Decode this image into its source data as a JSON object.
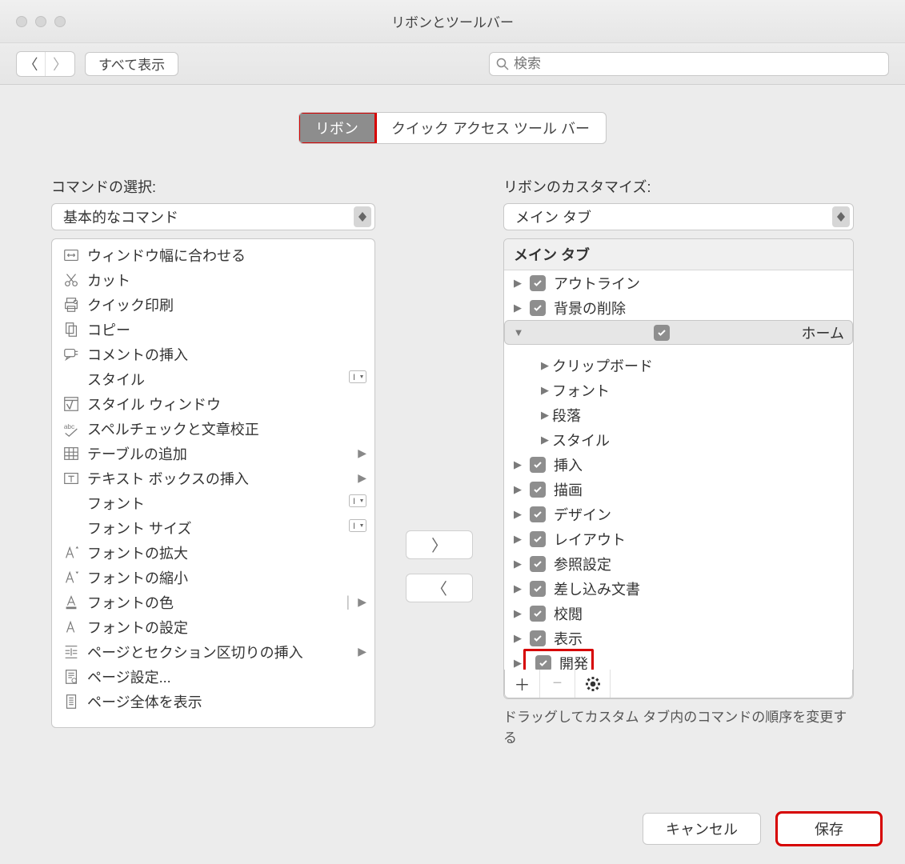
{
  "window": {
    "title": "リボンとツールバー"
  },
  "toolbar": {
    "show_all": "すべて表示",
    "search_placeholder": "検索"
  },
  "tabs": {
    "ribbon": "リボン",
    "qat": "クイック アクセス ツール バー"
  },
  "left": {
    "label": "コマンドの選択:",
    "select_value": "基本的なコマンド",
    "items": [
      {
        "label": "ウィンドウ幅に合わせる",
        "icon": "fitwidth"
      },
      {
        "label": "カット",
        "icon": "cut"
      },
      {
        "label": "クイック印刷",
        "icon": "print"
      },
      {
        "label": "コピー",
        "icon": "copy"
      },
      {
        "label": "コメントの挿入",
        "icon": "comment"
      },
      {
        "label": "スタイル",
        "icon": "",
        "extra": "style"
      },
      {
        "label": "スタイル ウィンドウ",
        "icon": "stylewin"
      },
      {
        "label": "スペルチェックと文章校正",
        "icon": "spell"
      },
      {
        "label": "テーブルの追加",
        "icon": "table",
        "sub": true
      },
      {
        "label": "テキスト ボックスの挿入",
        "icon": "textbox",
        "sub": true
      },
      {
        "label": "フォント",
        "icon": "",
        "extra": "style"
      },
      {
        "label": "フォント サイズ",
        "icon": "",
        "extra": "style"
      },
      {
        "label": "フォントの拡大",
        "icon": "fontplus"
      },
      {
        "label": "フォントの縮小",
        "icon": "fontminus"
      },
      {
        "label": "フォントの色",
        "icon": "fontcolor",
        "sub": true,
        "sep": true
      },
      {
        "label": "フォントの設定",
        "icon": "fontset"
      },
      {
        "label": "ページとセクション区切りの挿入",
        "icon": "break",
        "sub": true
      },
      {
        "label": "ページ設定...",
        "icon": "pagesetup"
      },
      {
        "label": "ページ全体を表示",
        "icon": "pagefull"
      }
    ]
  },
  "right": {
    "label": "リボンのカスタマイズ:",
    "select_value": "メイン タブ",
    "header": "メイン タブ",
    "nodes": [
      {
        "label": "アウトライン",
        "check": true
      },
      {
        "label": "背景の削除",
        "check": true
      },
      {
        "label": "ホーム",
        "check": true,
        "expanded": true,
        "selected": true,
        "children": [
          {
            "label": "クリップボード"
          },
          {
            "label": "フォント"
          },
          {
            "label": "段落"
          },
          {
            "label": "スタイル"
          }
        ]
      },
      {
        "label": "挿入",
        "check": true
      },
      {
        "label": "描画",
        "check": true
      },
      {
        "label": "デザイン",
        "check": true
      },
      {
        "label": "レイアウト",
        "check": true
      },
      {
        "label": "参照設定",
        "check": true
      },
      {
        "label": "差し込み文書",
        "check": true
      },
      {
        "label": "校閲",
        "check": true
      },
      {
        "label": "表示",
        "check": true
      },
      {
        "label": "開発",
        "check": true,
        "highlight": true
      }
    ],
    "hint": "ドラッグしてカスタム タブ内のコマンドの順序を変更する"
  },
  "footer": {
    "cancel": "キャンセル",
    "save": "保存"
  }
}
